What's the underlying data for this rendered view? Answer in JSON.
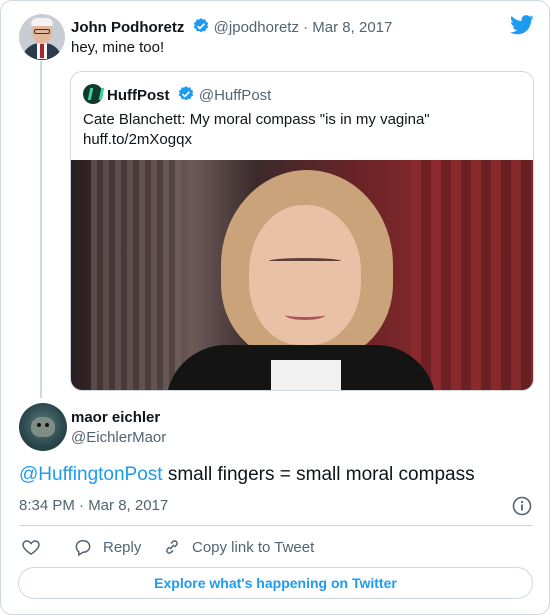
{
  "tweet": {
    "author_name": "John Podhoretz",
    "author_handle": "@jpodhoretz",
    "separator": "·",
    "date": "Mar 8, 2017",
    "text": "hey, mine too!"
  },
  "quoted_tweet": {
    "author_name": "HuffPost",
    "author_handle": "@HuffPost",
    "text_line1": "Cate Blanchett: My moral compass \"is in my vagina\"",
    "text_line2": "huff.to/2mXogqx"
  },
  "reply": {
    "author_name": "maor eichler",
    "author_handle": "@EichlerMaor",
    "mention": "@HuffingtonPost",
    "text": " small fingers = small moral compass",
    "timestamp": "8:34 PM · Mar 8, 2017"
  },
  "actions": {
    "reply_label": "Reply",
    "copy_label": "Copy link to Tweet"
  },
  "footer": {
    "explore_label": "Explore what's happening on Twitter"
  },
  "colors": {
    "accent": "#1d9bf0",
    "muted": "#536471",
    "border": "#cfd9de",
    "huffpost_logo": "#0f3a2c"
  },
  "icons": [
    "verified-badge-icon",
    "twitter-logo-icon",
    "huffpost-logo-icon",
    "info-icon",
    "heart-icon",
    "reply-bubble-icon",
    "link-icon"
  ]
}
